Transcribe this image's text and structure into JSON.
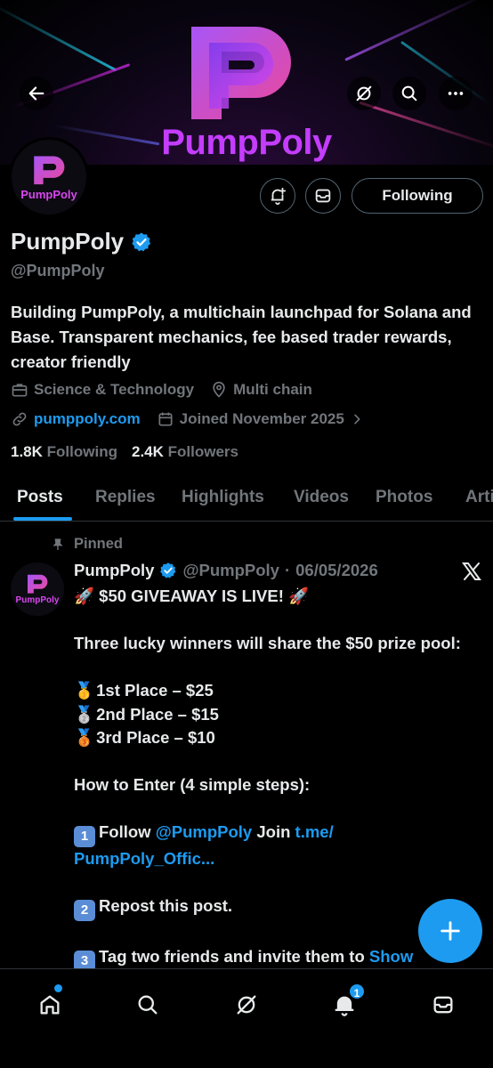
{
  "banner": {
    "brand_title": "PumpPoly"
  },
  "profile": {
    "avatar_label": "PumpPoly",
    "name": "PumpPoly",
    "handle": "@PumpPoly",
    "bio": "Building PumpPoly, a multichain launchpad for Solana and Base. Transparent mechanics, fee based trader rewards, creator friendly",
    "category": "Science & Technology",
    "location": "Multi chain",
    "website": "pumppoly.com",
    "joined": "Joined November 2025",
    "following_count": "1.8K",
    "following_label": "Following",
    "followers_count": "2.4K",
    "followers_label": "Followers",
    "follow_button": "Following"
  },
  "tabs": [
    "Posts",
    "Replies",
    "Highlights",
    "Videos",
    "Photos",
    "Articles"
  ],
  "post": {
    "pinned_label": "Pinned",
    "author": "PumpPoly",
    "handle": "@PumpPoly",
    "separator": "·",
    "date": "06/05/2026",
    "avatar_label": "PumpPoly",
    "headline": "🚀 $50 GIVEAWAY IS LIVE! 🚀",
    "intro": "Three lucky winners will share the $50 prize pool:",
    "places": [
      {
        "medal": "🥇",
        "text": "1st Place – $25"
      },
      {
        "medal": "🥈",
        "text": "2nd Place – $15"
      },
      {
        "medal": "🥉",
        "text": "3rd Place – $10"
      }
    ],
    "how_to": "How to Enter (4 simple steps):",
    "step1_num": "1",
    "step1_text": "Follow",
    "step1_mention": "@PumpPoly",
    "step1_join": "Join",
    "step1_link": "t.me/ PumpPoly_Offic...",
    "step2_num": "2",
    "step2_text": "Repost this post.",
    "step3_num": "3",
    "step3_text": "Tag two friends and invite them to",
    "step3_link": "Show"
  },
  "nav": {
    "notification_count": "1"
  },
  "colors": {
    "accent": "#1d9bf0",
    "brand": "#c43dff",
    "muted": "#71767b"
  }
}
